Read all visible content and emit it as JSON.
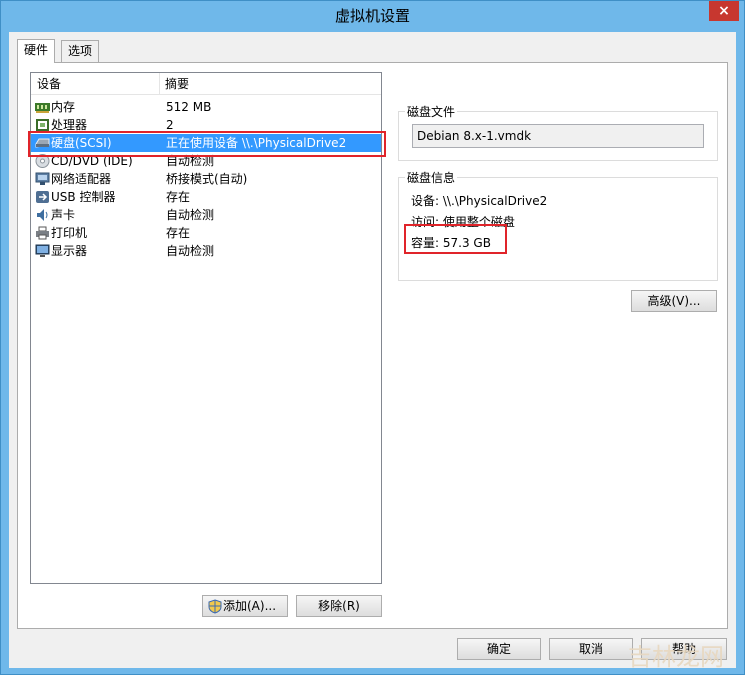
{
  "window": {
    "title": "虚拟机设置",
    "close_label": "×"
  },
  "tabs": [
    {
      "label": "硬件"
    },
    {
      "label": "选项"
    }
  ],
  "device_list": {
    "columns": {
      "device": "设备",
      "summary": "摘要"
    },
    "rows": [
      {
        "device": "内存",
        "summary": "512 MB",
        "icon": "memory-icon"
      },
      {
        "device": "处理器",
        "summary": "2",
        "icon": "processor-icon"
      },
      {
        "device": "硬盘(SCSI)",
        "summary": "正在使用设备 \\\\.\\PhysicalDrive2",
        "icon": "hard-disk-icon"
      },
      {
        "device": "CD/DVD (IDE)",
        "summary": "自动检测",
        "icon": "cd-dvd-icon"
      },
      {
        "device": "网络适配器",
        "summary": "桥接模式(自动)",
        "icon": "network-adapter-icon"
      },
      {
        "device": "USB 控制器",
        "summary": "存在",
        "icon": "usb-icon"
      },
      {
        "device": "声卡",
        "summary": "自动检测",
        "icon": "sound-card-icon"
      },
      {
        "device": "打印机",
        "summary": "存在",
        "icon": "printer-icon"
      },
      {
        "device": "显示器",
        "summary": "自动检测",
        "icon": "display-icon"
      }
    ],
    "selected_index": 2
  },
  "buttons": {
    "add": "添加(A)...",
    "remove": "移除(R)",
    "advanced": "高级(V)...",
    "ok": "确定",
    "cancel": "取消",
    "help": "帮助"
  },
  "disk_file": {
    "title": "磁盘文件",
    "value": "Debian 8.x-1.vmdk"
  },
  "disk_info": {
    "title": "磁盘信息",
    "device": "设备: \\\\.\\PhysicalDrive2",
    "access": "访问: 使用整个磁盘",
    "capacity": "容量: 57.3 GB"
  },
  "watermark": "吉林龙网",
  "colors": {
    "selection": "#3399ff",
    "highlight_box": "#e0242a",
    "titlebar": "#6fb8ea"
  }
}
